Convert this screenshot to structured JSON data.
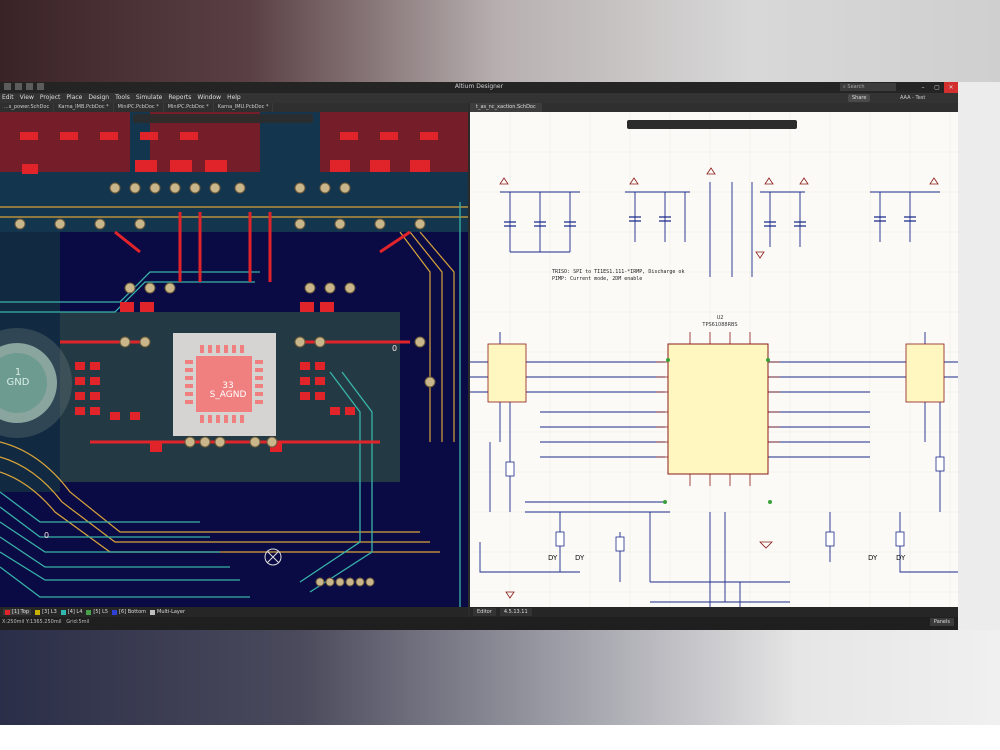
{
  "window": {
    "title": "Altium Designer",
    "search_placeholder": "Search",
    "share_label": "Share",
    "user_label": "AAA - Test"
  },
  "menu": [
    "Edit",
    "View",
    "Project",
    "Place",
    "Design",
    "Tools",
    "Simulate",
    "Reports",
    "Window",
    "Help"
  ],
  "doc_tabs_left": [
    "...s_power.SchDoc",
    "Karna_IMB.PcbDoc *",
    "MiniPC.PcbDoc *",
    "MiniPC.PcbDoc *",
    "Karna_IMU.PcbDoc *"
  ],
  "doc_tab_right": "t_as_nc_xaction.SchDoc",
  "pcb": {
    "gnd_pad": {
      "number": "1",
      "net": "GND"
    },
    "center_pad": {
      "number": "33",
      "net": "S_AGND"
    },
    "zero_labels": [
      "0",
      "0"
    ]
  },
  "schematic": {
    "note_lines": [
      "TRISO: SPI to TI1ES1.111-*IRMP, Discharge ok",
      "PIMP: Current mode, 2DM enable"
    ],
    "chip_ref": "U2",
    "chip_name": "TPS61088RBS",
    "labels": {
      "dy": "DY",
      "vbat": "VBAT",
      "gnd": "GND"
    }
  },
  "layers": [
    {
      "label": "[1] Top",
      "color": "#e0242a",
      "active": true
    },
    {
      "label": "[3] L3",
      "color": "#c8b400",
      "active": false
    },
    {
      "label": "[4] L4",
      "color": "#2fb7b0",
      "active": false
    },
    {
      "label": "[5] L5",
      "color": "#49a04a",
      "active": false
    },
    {
      "label": "[6] Bottom",
      "color": "#2e3fd6",
      "active": false
    },
    {
      "label": "Multi-Layer",
      "color": "#c0c0c0",
      "active": false
    }
  ],
  "sch_bottom_tabs": [
    "Editor",
    "4.5.13.11"
  ],
  "status": {
    "coords": "X:250mil Y:1365.250mil",
    "grid": "Grid:5mil",
    "panels_label": "Panels"
  },
  "colors": {
    "pcb_background": "#0a0a45",
    "top_layer": "#e0242a",
    "schematic_background": "#fbfaf6",
    "chip_fill": "#fff6c0"
  }
}
